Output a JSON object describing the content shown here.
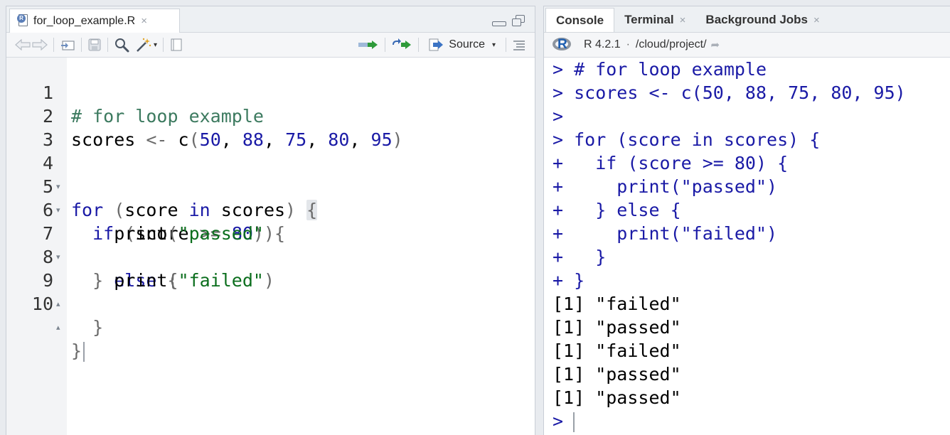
{
  "source_pane": {
    "tab": {
      "filename": "for_loop_example.R",
      "close": "×"
    },
    "toolbar": {
      "source_label": "Source"
    },
    "lines": [
      {
        "num": "1",
        "fold": ""
      },
      {
        "num": "2",
        "fold": ""
      },
      {
        "num": "3",
        "fold": ""
      },
      {
        "num": "4",
        "fold": "▾"
      },
      {
        "num": "5",
        "fold": "▾"
      },
      {
        "num": "6",
        "fold": ""
      },
      {
        "num": "7",
        "fold": "▾"
      },
      {
        "num": "8",
        "fold": ""
      },
      {
        "num": "9",
        "fold": "▴"
      },
      {
        "num": "10",
        "fold": "▴"
      }
    ],
    "code": {
      "l1": "# for loop example",
      "l2_a": "scores ",
      "l2_op": "<-",
      "l2_b": " c",
      "l2_p1": "(",
      "l2_n1": "50",
      "l2_n2": "88",
      "l2_n3": "75",
      "l2_n4": "80",
      "l2_n5": "95",
      "l2_comma": ", ",
      "l2_p2": ")",
      "l4_for": "for",
      "l4_p1": " (",
      "l4_var": "score ",
      "l4_in": "in",
      "l4_rest": " scores",
      "l4_p2": ")",
      "l4_brace": "{",
      "l5_if": "if",
      "l5_p1": " (",
      "l5_var": "score ",
      "l5_op": ">=",
      "l5_num": "80",
      "l5_p2": ")",
      "l5_brace": " {",
      "l6_fn": "print",
      "l6_str": "\"passed\"",
      "l7_close": "} ",
      "l7_else": "else",
      "l7_brace": " {",
      "l8_fn": "print",
      "l8_str": "\"failed\"",
      "l9": "}",
      "l10": "}"
    }
  },
  "console_pane": {
    "tabs": [
      {
        "label": "Console"
      },
      {
        "label": "Terminal",
        "close": "×"
      },
      {
        "label": "Background Jobs",
        "close": "×"
      }
    ],
    "version": "R 4.2.1",
    "separator": "·",
    "path": "/cloud/project/",
    "lines": [
      {
        "text": "> # for loop example",
        "kind": "in"
      },
      {
        "text": "> scores <- c(50, 88, 75, 80, 95)",
        "kind": "in"
      },
      {
        "text": ">",
        "kind": "in"
      },
      {
        "text": "> for (score in scores) {",
        "kind": "in"
      },
      {
        "text": "+   if (score >= 80) {",
        "kind": "in"
      },
      {
        "text": "+     print(\"passed\")",
        "kind": "in"
      },
      {
        "text": "+   } else {",
        "kind": "in"
      },
      {
        "text": "+     print(\"failed\")",
        "kind": "in"
      },
      {
        "text": "+   }",
        "kind": "in"
      },
      {
        "text": "+ }",
        "kind": "in"
      },
      {
        "text": "[1] \"failed\"",
        "kind": "out"
      },
      {
        "text": "[1] \"passed\"",
        "kind": "out"
      },
      {
        "text": "[1] \"failed\"",
        "kind": "out"
      },
      {
        "text": "[1] \"passed\"",
        "kind": "out"
      },
      {
        "text": "[1] \"passed\"",
        "kind": "out"
      },
      {
        "text": ">",
        "kind": "in"
      }
    ]
  }
}
